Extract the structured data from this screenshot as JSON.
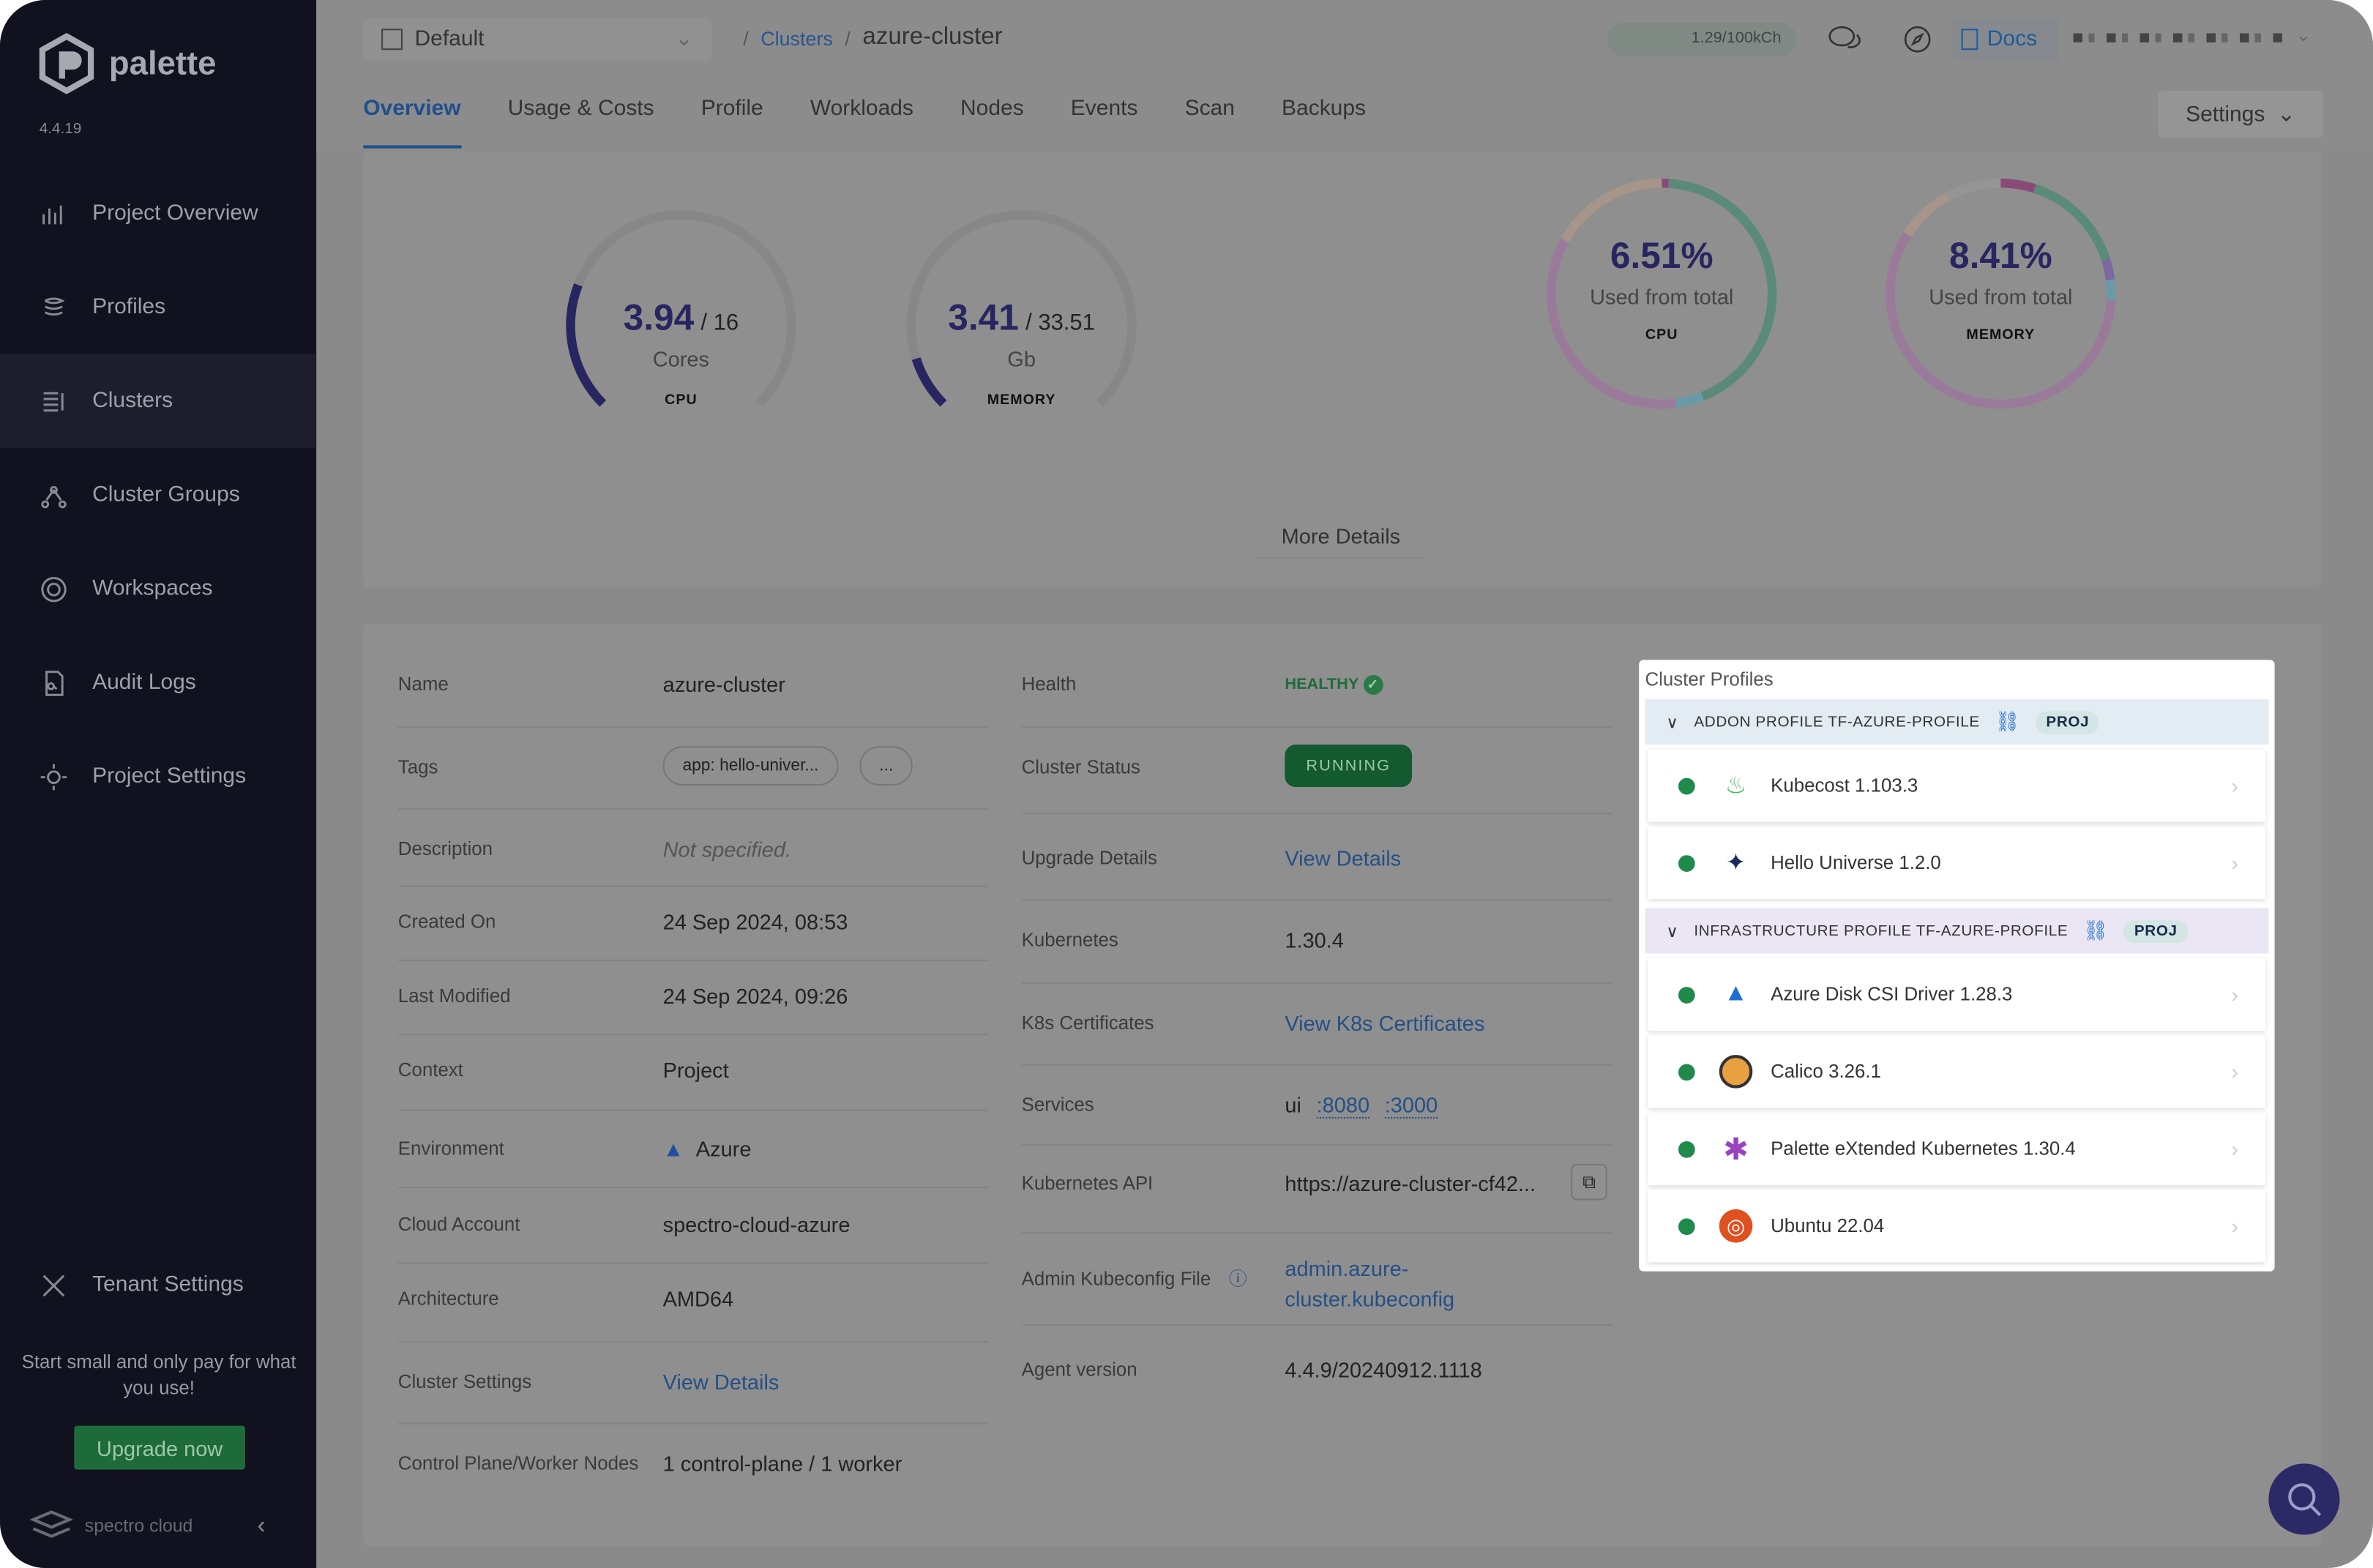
{
  "app": {
    "name": "palette",
    "version": "4.4.19",
    "footer_brand": "spectro cloud"
  },
  "sidebar": {
    "items": [
      {
        "label": "Project Overview",
        "icon": "chart-icon"
      },
      {
        "label": "Profiles",
        "icon": "stack-icon"
      },
      {
        "label": "Clusters",
        "icon": "clusters-icon",
        "selected": true
      },
      {
        "label": "Cluster Groups",
        "icon": "cluster-groups-icon"
      },
      {
        "label": "Workspaces",
        "icon": "workspaces-icon"
      },
      {
        "label": "Audit Logs",
        "icon": "audit-icon"
      },
      {
        "label": "Project Settings",
        "icon": "gear-icon"
      }
    ],
    "tenant_settings": "Tenant Settings",
    "promo": "Start small and only pay for what you use!",
    "upgrade": "Upgrade now"
  },
  "header": {
    "project": "Default",
    "breadcrumb": [
      "Clusters",
      "azure-cluster"
    ],
    "usage": "1.29/100kCh",
    "docs": "Docs"
  },
  "tabs": [
    {
      "label": "Overview",
      "active": true
    },
    {
      "label": "Usage & Costs"
    },
    {
      "label": "Profile"
    },
    {
      "label": "Workloads"
    },
    {
      "label": "Nodes"
    },
    {
      "label": "Events"
    },
    {
      "label": "Scan"
    },
    {
      "label": "Backups"
    }
  ],
  "settings_label": "Settings",
  "gauges": [
    {
      "used": "3.94",
      "total": "/ 16",
      "unit": "Cores",
      "label": "CPU",
      "fraction": 0.2463,
      "color": "#272660"
    },
    {
      "used": "3.41",
      "total": "/ 33.51",
      "unit": "Gb",
      "label": "MEMORY",
      "fraction": 0.1018,
      "color": "#272660"
    }
  ],
  "donuts": [
    {
      "percent": "6.51%",
      "caption": "Used from total",
      "label": "CPU",
      "segments": [
        {
          "fraction": 0.01,
          "color": "#8a4a78"
        },
        {
          "fraction": 0.43,
          "color": "#5a8a78"
        },
        {
          "fraction": 0.04,
          "color": "#6a9aa8"
        },
        {
          "fraction": 0.35,
          "color": "#9a7a9a"
        },
        {
          "fraction": 0.17,
          "color": "#a8958a"
        }
      ]
    },
    {
      "percent": "8.41%",
      "caption": "Used from total",
      "label": "MEMORY",
      "segments": [
        {
          "fraction": 0.05,
          "color": "#8a4a78"
        },
        {
          "fraction": 0.15,
          "color": "#5a8a78"
        },
        {
          "fraction": 0.03,
          "color": "#7a6aa0"
        },
        {
          "fraction": 0.03,
          "color": "#6a9aa8"
        },
        {
          "fraction": 0.58,
          "color": "#9a7a9a"
        },
        {
          "fraction": 0.08,
          "color": "#a8958a"
        },
        {
          "fraction": 0.08,
          "color": "#959595"
        }
      ]
    }
  ],
  "more_details": "More Details",
  "details_left": [
    {
      "label": "Name",
      "value": "azure-cluster"
    },
    {
      "label": "Tags",
      "tags": [
        "app: hello-univer...",
        "..."
      ]
    },
    {
      "label": "Description",
      "value": "Not specified."
    },
    {
      "label": "Created On",
      "value": "24 Sep 2024, 08:53"
    },
    {
      "label": "Last Modified",
      "value": "24 Sep 2024, 09:26"
    },
    {
      "label": "Context",
      "value": "Project"
    },
    {
      "label": "Environment",
      "value": "Azure"
    },
    {
      "label": "Cloud Account",
      "value": "spectro-cloud-azure"
    },
    {
      "label": "Architecture",
      "value": "AMD64"
    },
    {
      "label": "Cluster Settings",
      "value": "View Details",
      "link": true
    },
    {
      "label": "Control Plane/Worker Nodes",
      "value": "1 control-plane / 1 worker"
    }
  ],
  "details_mid": [
    {
      "label": "Health",
      "value": "HEALTHY"
    },
    {
      "label": "Cluster Status",
      "value": "RUNNING"
    },
    {
      "label": "Upgrade Details",
      "value": "View Details",
      "link": true
    },
    {
      "label": "Kubernetes",
      "value": "1.30.4"
    },
    {
      "label": "K8s Certificates",
      "value": "View K8s Certificates",
      "link": true
    },
    {
      "label": "Services",
      "prefix": "ui",
      "ports": [
        ":8080",
        ":3000"
      ]
    },
    {
      "label": "Kubernetes API",
      "value": "https://azure-cluster-cf42..."
    },
    {
      "label": "Admin Kubeconfig File",
      "value": "admin.azure-cluster.kubeconfig",
      "link": true
    },
    {
      "label": "Agent version",
      "value": "4.4.9/20240912.1118"
    }
  ],
  "cluster_profiles": {
    "title": "Cluster Profiles",
    "groups": [
      {
        "name": "ADDON PROFILE TF-AZURE-PROFILE",
        "badge": "PROJ",
        "bg": "#e3ebf3",
        "items": [
          {
            "name": "Kubecost 1.103.3",
            "icon": "kubecost-icon"
          },
          {
            "name": "Hello Universe 1.2.0",
            "icon": "hello-universe-icon"
          }
        ]
      },
      {
        "name": "INFRASTRUCTURE PROFILE TF-AZURE-PROFILE",
        "badge": "PROJ",
        "bg": "#ebe6f4",
        "items": [
          {
            "name": "Azure Disk CSI Driver 1.28.3",
            "icon": "azure-icon"
          },
          {
            "name": "Calico 3.26.1",
            "icon": "calico-icon"
          },
          {
            "name": "Palette eXtended Kubernetes 1.30.4",
            "icon": "palette-k8s-icon"
          },
          {
            "name": "Ubuntu 22.04",
            "icon": "ubuntu-icon"
          }
        ]
      }
    ]
  }
}
